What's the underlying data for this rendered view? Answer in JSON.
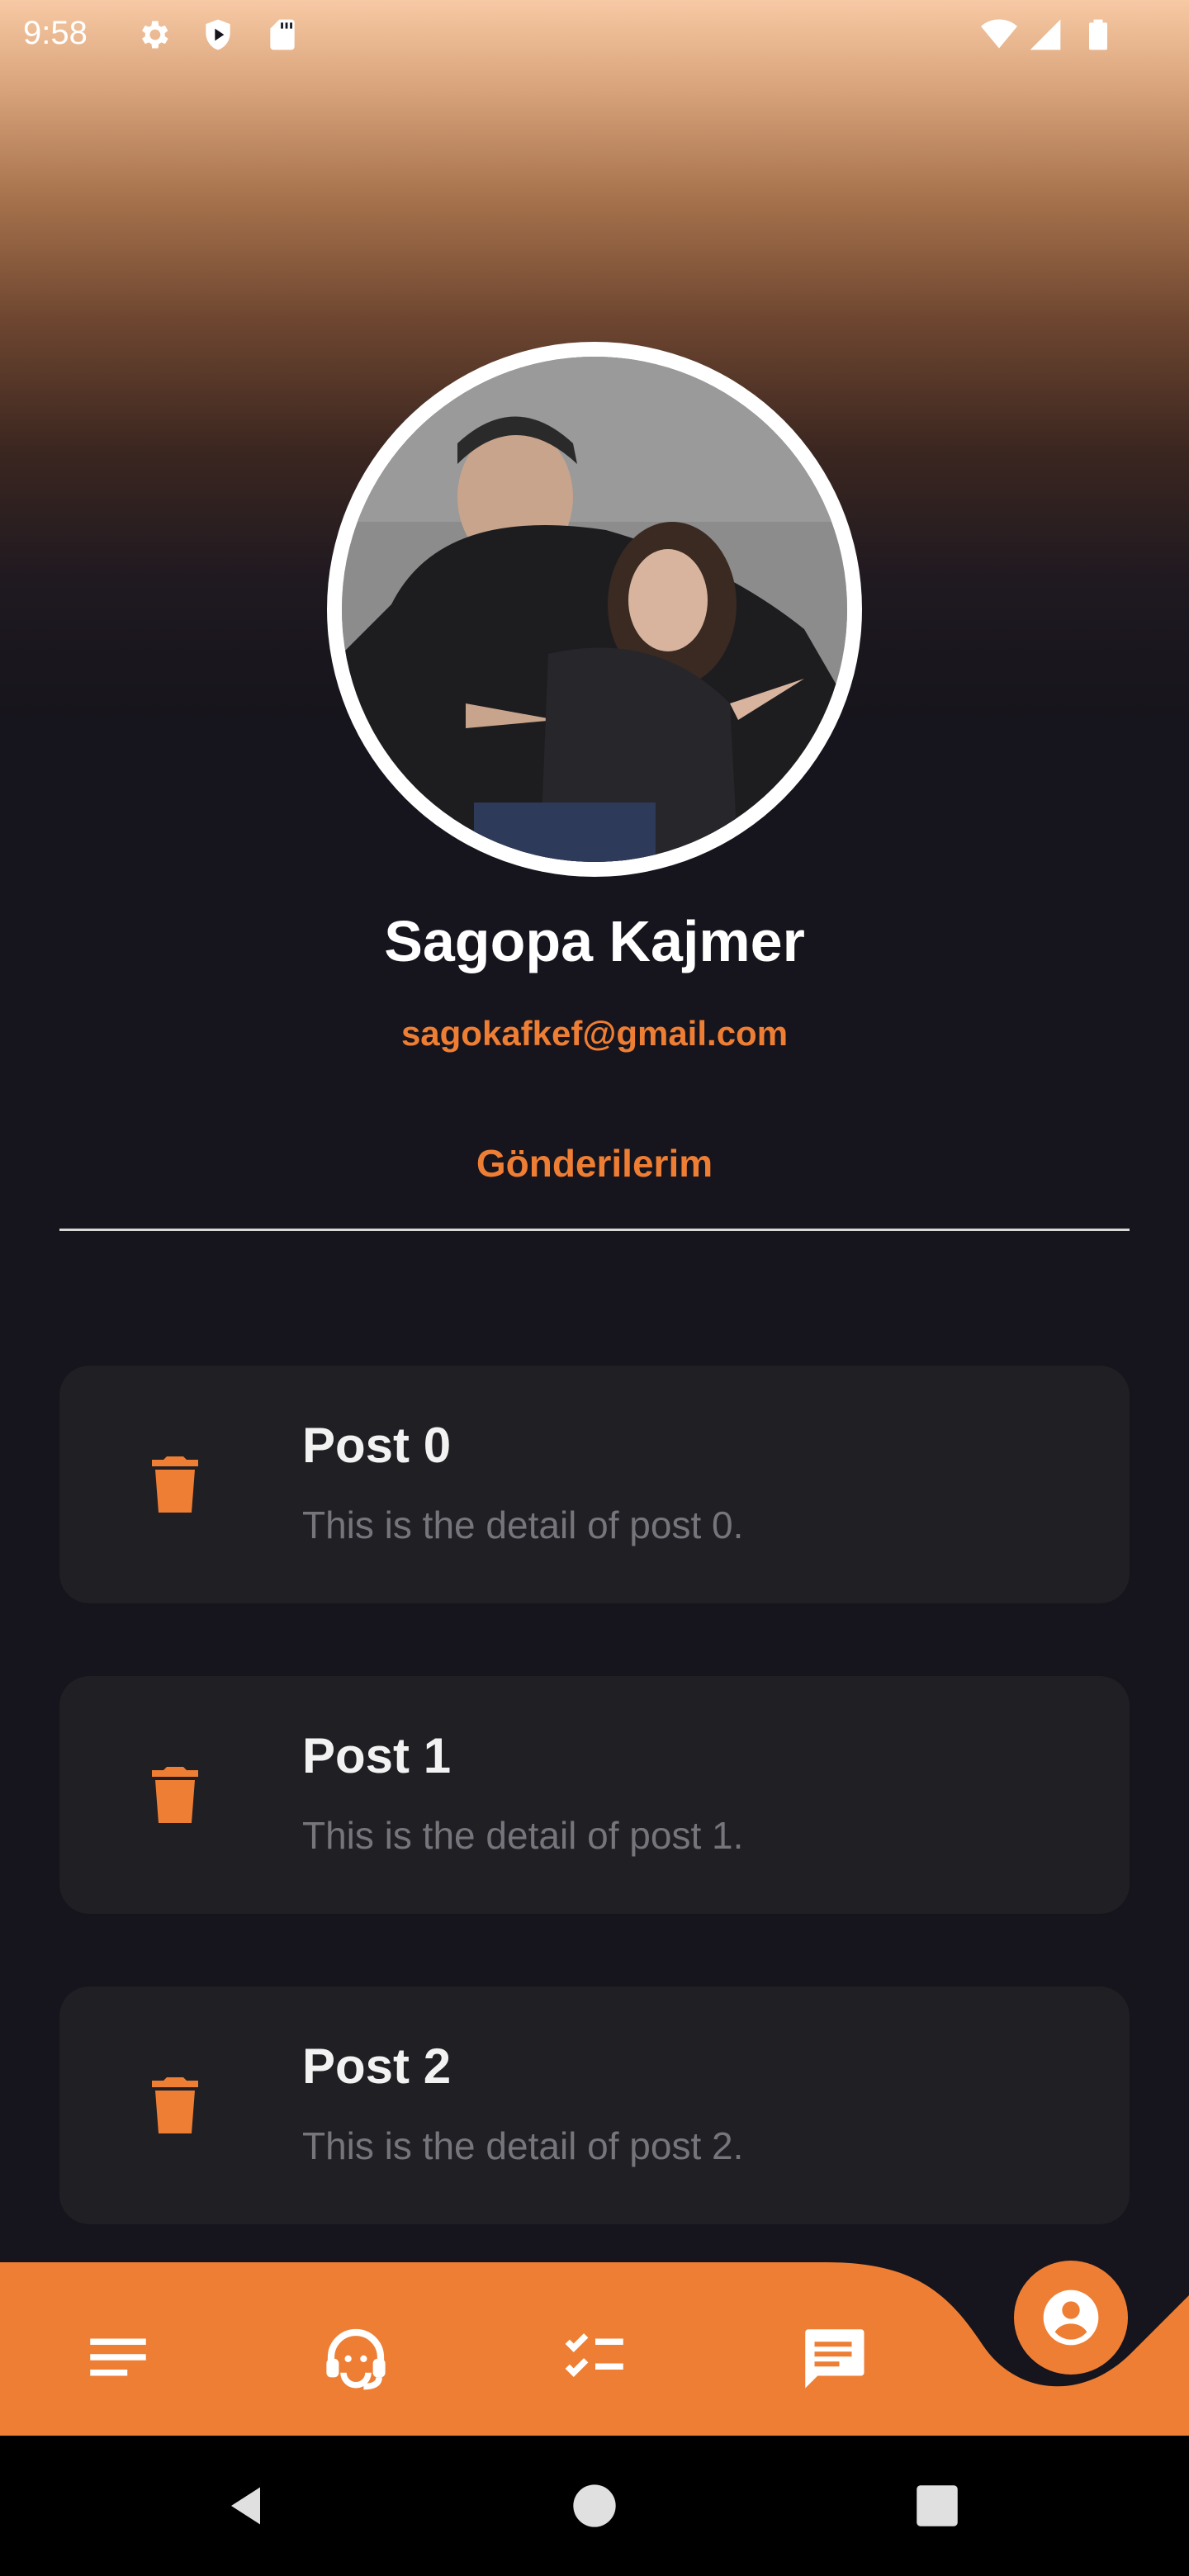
{
  "status_bar": {
    "time": "9:58"
  },
  "profile": {
    "name": "Sagopa Kajmer",
    "email": "sagokafkef@gmail.com",
    "avatar": "profile-photo"
  },
  "tabs": [
    {
      "label": "Gönderilerim",
      "selected": true
    }
  ],
  "posts": [
    {
      "title": "Post 0",
      "detail": "This is the detail of post 0."
    },
    {
      "title": "Post 1",
      "detail": "This is the detail of post 1."
    },
    {
      "title": "Post 2",
      "detail": "This is the detail of post 2."
    }
  ],
  "bottom_nav": {
    "items": [
      {
        "icon": "list-icon"
      },
      {
        "icon": "support-agent-icon"
      },
      {
        "icon": "checklist-icon"
      },
      {
        "icon": "chat-icon"
      },
      {
        "icon": "account-circle-icon",
        "selected": true
      }
    ]
  },
  "colors": {
    "accent": "#ee7e34",
    "background": "#16141c",
    "card": "#201f24"
  }
}
